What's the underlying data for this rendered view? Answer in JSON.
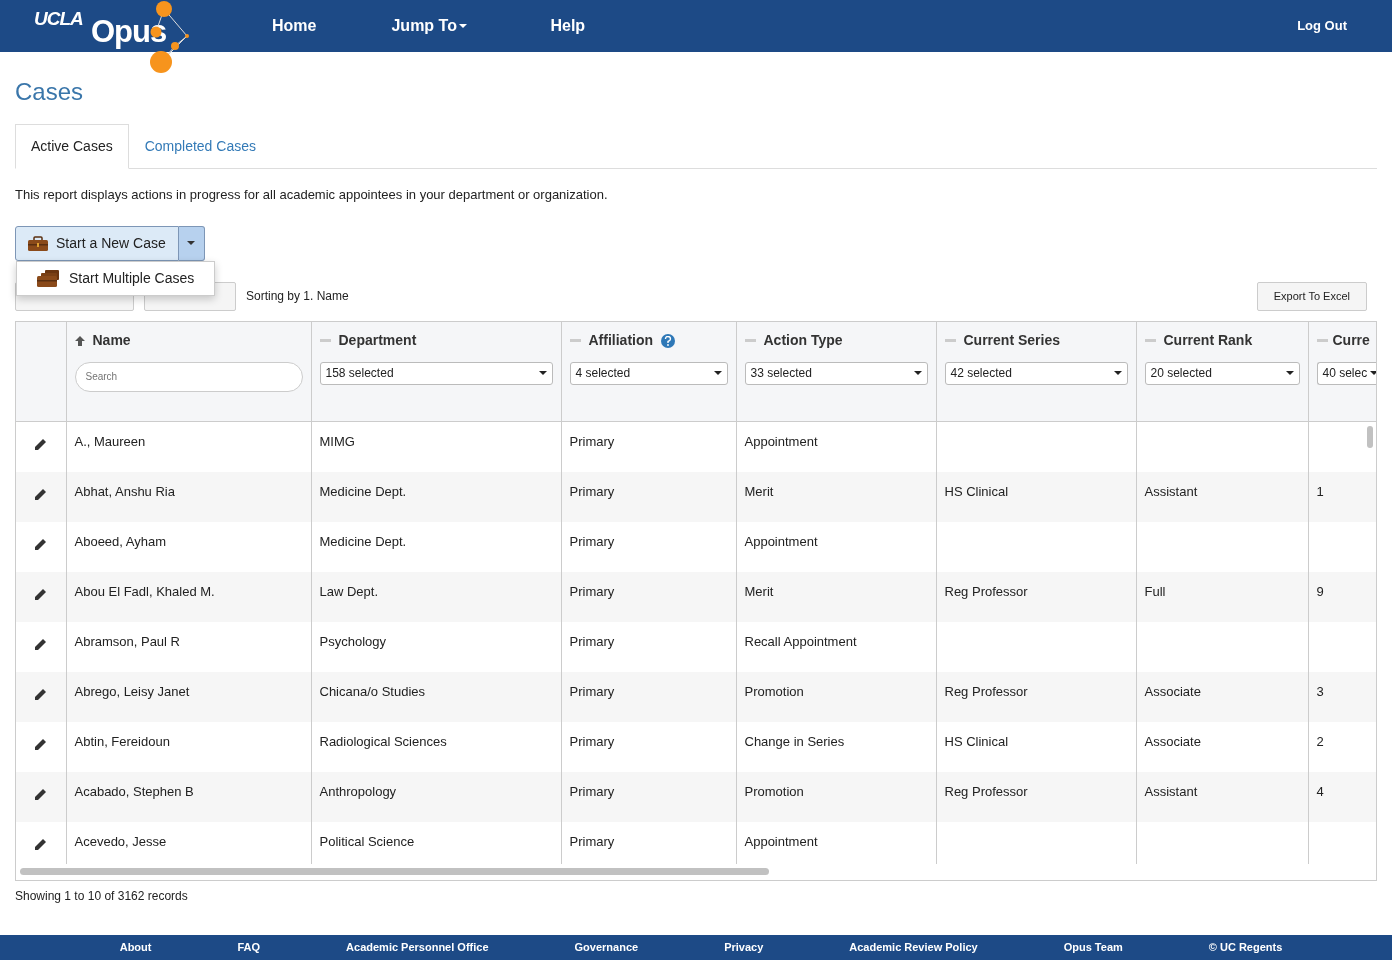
{
  "header": {
    "brand_small": "UCLA",
    "brand": "Opus",
    "nav": [
      {
        "label": "Home",
        "dropdown": false
      },
      {
        "label": "Jump To",
        "dropdown": true
      },
      {
        "label": "Help",
        "dropdown": false
      }
    ],
    "logout": "Log Out"
  },
  "page_title": "Cases",
  "tabs": [
    {
      "label": "Active Cases",
      "selected": true
    },
    {
      "label": "Completed Cases",
      "selected": false
    }
  ],
  "description": "This report displays actions in progress for all academic appointees in your department or organization.",
  "new_case_button": {
    "label": "Start a New Case",
    "menu_open": true,
    "menu": [
      {
        "label": "Start Multiple Cases"
      }
    ]
  },
  "toolbar": {
    "sorting": "Sorting by 1. Name",
    "export": "Export To Excel"
  },
  "table": {
    "columns": [
      {
        "label": "Name",
        "sorted": true,
        "help": false,
        "filter": {
          "kind": "search",
          "placeholder": "Search"
        }
      },
      {
        "label": "Department",
        "sorted": false,
        "help": false,
        "filter": {
          "kind": "select",
          "value": "158 selected"
        }
      },
      {
        "label": "Affiliation",
        "sorted": false,
        "help": true,
        "filter": {
          "kind": "select",
          "value": "4 selected"
        }
      },
      {
        "label": "Action Type",
        "sorted": false,
        "help": false,
        "filter": {
          "kind": "select",
          "value": "33 selected"
        }
      },
      {
        "label": "Current Series",
        "sorted": false,
        "help": false,
        "filter": {
          "kind": "select",
          "value": "42 selected"
        }
      },
      {
        "label": "Current Rank",
        "sorted": false,
        "help": false,
        "filter": {
          "kind": "select",
          "value": "20 selected"
        }
      },
      {
        "label": "Curre",
        "sorted": false,
        "help": false,
        "filter": {
          "kind": "select",
          "value": "40 selec"
        }
      }
    ],
    "rows": [
      {
        "cells": [
          "A., Maureen",
          "MIMG",
          "Primary",
          "Appointment",
          null,
          null,
          null
        ]
      },
      {
        "cells": [
          "Abhat, Anshu Ria",
          "Medicine Dept.",
          "Primary",
          "Merit",
          "HS Clinical",
          "Assistant",
          "1"
        ]
      },
      {
        "cells": [
          "Aboeed, Ayham",
          "Medicine Dept.",
          "Primary",
          "Appointment",
          null,
          null,
          null
        ]
      },
      {
        "cells": [
          "Abou El Fadl, Khaled M.",
          "Law Dept.",
          "Primary",
          "Merit",
          "Reg Professor",
          "Full",
          "9"
        ]
      },
      {
        "cells": [
          "Abramson, Paul R",
          "Psychology",
          "Primary",
          "Recall Appointment",
          null,
          null,
          null
        ]
      },
      {
        "cells": [
          "Abrego, Leisy Janet",
          "Chicana/o Studies",
          "Primary",
          "Promotion",
          "Reg Professor",
          "Associate",
          "3"
        ]
      },
      {
        "cells": [
          "Abtin, Fereidoun",
          "Radiological Sciences",
          "Primary",
          "Change in Series",
          "HS Clinical",
          "Associate",
          "2"
        ]
      },
      {
        "cells": [
          "Acabado, Stephen B",
          "Anthropology",
          "Primary",
          "Promotion",
          "Reg Professor",
          "Assistant",
          "4"
        ]
      },
      {
        "cells": [
          "Acevedo, Jesse",
          "Political Science",
          "Primary",
          "Appointment",
          null,
          null,
          null
        ]
      }
    ]
  },
  "status": "Showing 1 to 10 of 3162 records",
  "footer": {
    "links": [
      "About",
      "FAQ",
      "Academic Personnel Office",
      "Governance",
      "Privacy",
      "Academic Review Policy",
      "Opus Team",
      "© UC Regents"
    ]
  }
}
